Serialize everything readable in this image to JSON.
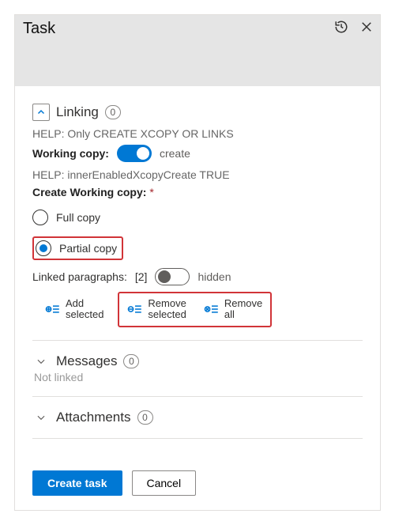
{
  "header": {
    "title": "Task"
  },
  "linking": {
    "title": "Linking",
    "count": "0",
    "help1": "HELP: Only CREATE XCOPY OR LINKS",
    "workingCopyLabel": "Working copy:",
    "workingCopyToggleText": "create",
    "help2": "HELP: innerEnabledXcopyCreate TRUE",
    "createLabel": "Create Working copy:",
    "fullCopy": "Full copy",
    "partialCopy": "Partial copy",
    "linkedParaLabel": "Linked paragraphs:",
    "linkedParaCount": "[2]",
    "hiddenLabel": "hidden",
    "addSelected": "Add\nselected",
    "removeSelected": "Remove\nselected",
    "removeAll": "Remove\nall"
  },
  "messages": {
    "title": "Messages",
    "count": "0",
    "notLinked": "Not linked"
  },
  "attachments": {
    "title": "Attachments",
    "count": "0"
  },
  "footer": {
    "create": "Create task",
    "cancel": "Cancel"
  }
}
